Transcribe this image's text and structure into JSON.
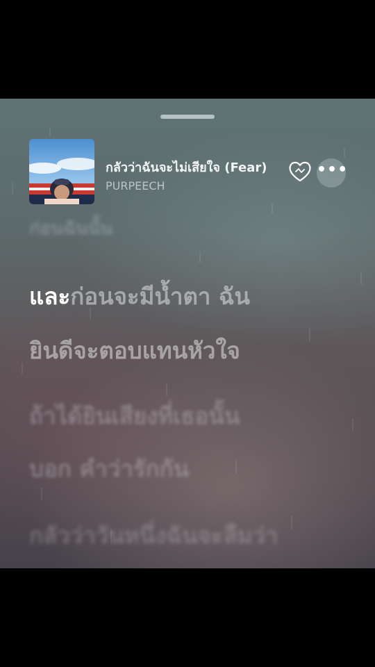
{
  "player": {
    "song_title": "กลัวว่าฉันจะไม่เสียใจ (Fear)",
    "artist": "PURPEECH",
    "icons": {
      "cover": "album-cover",
      "favorite": "heart-icon",
      "more": "more-icon",
      "grabber": "sheet-grabber"
    },
    "more_label": "•••"
  },
  "lyrics": {
    "previous": "ก่อนฉันนั้น",
    "current_line_1_sung": "และ",
    "current_line_1_rest": "ก่อนจะมีน้ำตา ฉัน",
    "current_line_2": "ยินดีจะตอบแทนหัวใจ",
    "next_line_1": "ถ้าได้ยินเสียงที่เธอนั้น",
    "next_line_2": "บอก คำว่ารักกัน",
    "next_line_3": "กลัวว่าวันหนึ่งฉันจะลืมว่า"
  }
}
